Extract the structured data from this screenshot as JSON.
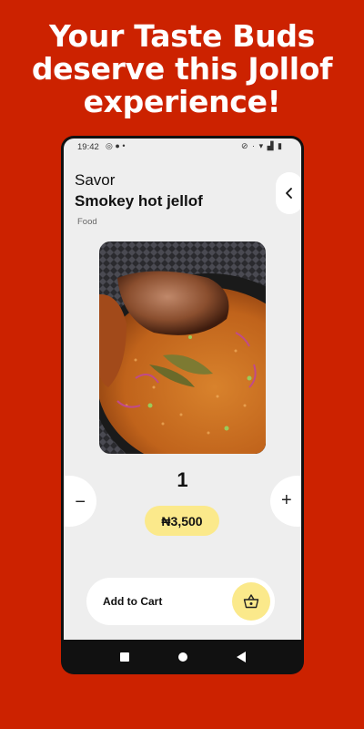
{
  "promo": {
    "headline": "Your Taste Buds\ndeserve this Jollof\nexperience!"
  },
  "status_bar": {
    "time": "19:42",
    "left_icons": [
      "whatsapp-icon",
      "chat-icon",
      "dot-icon"
    ],
    "right_icons": [
      "mute-icon",
      "signal-dot-icon",
      "wifi-icon",
      "cell-signal-icon",
      "battery-icon"
    ]
  },
  "product": {
    "brand": "Savor",
    "name": "Smokey hot jellof",
    "category": "Food",
    "image_icon": "jollof-rice-with-chicken-photo"
  },
  "quantity": {
    "value": "1",
    "minus_symbol": "−",
    "plus_symbol": "+"
  },
  "price": {
    "display": "₦3,500"
  },
  "cart": {
    "label": "Add to Cart",
    "icon": "basket-icon"
  },
  "colors": {
    "background": "#cc2200",
    "accent": "#fbe98b",
    "screen": "#eeeeee"
  }
}
